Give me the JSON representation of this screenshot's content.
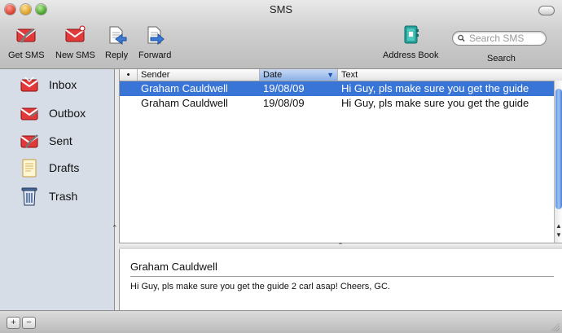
{
  "window": {
    "title": "SMS"
  },
  "toolbar": {
    "get_sms": "Get SMS",
    "new_sms": "New SMS",
    "reply": "Reply",
    "forward": "Forward",
    "address_book": "Address Book",
    "search_placeholder": "Search SMS",
    "search_label": "Search"
  },
  "sidebar": {
    "items": [
      {
        "label": "Inbox",
        "icon": "inbox-icon"
      },
      {
        "label": "Outbox",
        "icon": "outbox-icon"
      },
      {
        "label": "Sent",
        "icon": "sent-icon"
      },
      {
        "label": "Drafts",
        "icon": "drafts-icon"
      },
      {
        "label": "Trash",
        "icon": "trash-icon"
      }
    ]
  },
  "list": {
    "columns": {
      "flag": "•",
      "sender": "Sender",
      "date": "Date",
      "text": "Text"
    },
    "rows": [
      {
        "sender": "Graham Cauldwell",
        "date": "19/08/09",
        "text": "Hi Guy, pls make sure you get the guide",
        "selected": true
      },
      {
        "sender": "Graham Cauldwell",
        "date": "19/08/09",
        "text": "Hi Guy, pls make sure you get the guide",
        "selected": false
      }
    ]
  },
  "preview": {
    "from": "Graham Cauldwell",
    "body": "Hi Guy, pls make sure you get the guide 2 carl asap! Cheers, GC."
  },
  "bottombar": {
    "add": "+",
    "remove": "−"
  },
  "colors": {
    "selection": "#3875d7",
    "sidebar": "#d6dde6"
  }
}
